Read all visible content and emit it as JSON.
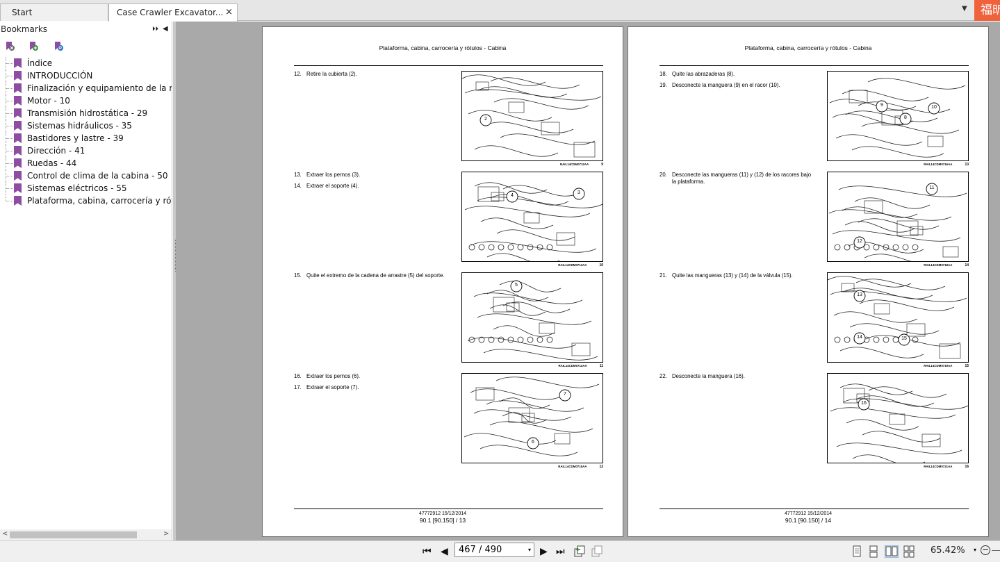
{
  "tabs": [
    {
      "label": "Start"
    },
    {
      "label": "Case Crawler Excavator...",
      "close": "×"
    }
  ],
  "tab_menu": "▼",
  "brand": "福昕",
  "sidebar": {
    "title": "Bookmarks",
    "expand": "⏵⏵",
    "collapse": "◀",
    "tools": [
      "delete-bookmark-icon",
      "add-bookmark-icon",
      "find-bookmark-icon"
    ],
    "items": [
      {
        "label": "Índice"
      },
      {
        "label": "INTRODUCCIÓN"
      },
      {
        "label": "Finalización y equipamiento de la máqu"
      },
      {
        "label": "Motor - 10"
      },
      {
        "label": "Transmisión hidrostática - 29"
      },
      {
        "label": "Sistemas hidráulicos - 35"
      },
      {
        "label": "Bastidores y lastre - 39"
      },
      {
        "label": "Dirección - 41"
      },
      {
        "label": "Ruedas - 44"
      },
      {
        "label": "Control de clima de la cabina - 50"
      },
      {
        "label": "Sistemas eléctricos - 55"
      },
      {
        "label": "Plataforma, cabina, carrocería y rótulos"
      }
    ],
    "scroll_left": "<",
    "scroll_right": ">"
  },
  "pages": [
    {
      "header": "Plataforma, cabina, carrocería y rótulos - Cabina",
      "steps": [
        {
          "n": "12.",
          "text": "Retire la cubierta (2)."
        },
        {
          "n": "13.",
          "text": "Extraer los pernos (3)."
        },
        {
          "n": "14.",
          "text": "Extraer el soporte (4)."
        },
        {
          "n": "15.",
          "text": "Quite el extremo de la cadena de arrastre (5) del soporte."
        },
        {
          "n": "16.",
          "text": "Extraer los pernos (6)."
        },
        {
          "n": "17.",
          "text": "Extraer el soporte (7)."
        }
      ],
      "figures": [
        {
          "code": "RAIL14CDM0712AA",
          "num": "9",
          "callouts": [
            "2"
          ]
        },
        {
          "code": "RAIL14CDM0713AA",
          "num": "10",
          "callouts": [
            "4",
            "3"
          ]
        },
        {
          "code": "RAIL14CDM0714AA",
          "num": "11",
          "callouts": [
            "5"
          ]
        },
        {
          "code": "RAIL14CDM0715AA",
          "num": "12",
          "callouts": [
            "7",
            "6"
          ]
        }
      ],
      "footer_line1": "47772912 15/12/2014",
      "footer_line2": "90.1 [90.150] / 13"
    },
    {
      "header": "Plataforma, cabina, carrocería y rótulos - Cabina",
      "steps": [
        {
          "n": "18.",
          "text": "Quite las abrazaderas (8)."
        },
        {
          "n": "19.",
          "text": "Desconecte la manguera (9) en el racor (10)."
        },
        {
          "n": "20.",
          "text": "Desconecte las mangueras (11) y (12) de los racores bajo la plataforma."
        },
        {
          "n": "21.",
          "text": "Quite las mangueras (13) y (14) de la válvula (15)."
        },
        {
          "n": "22.",
          "text": "Desconecte la manguera (16)."
        }
      ],
      "figures": [
        {
          "code": "RAIL14CDM0716AA",
          "num": "13",
          "callouts": [
            "9",
            "10",
            "8"
          ]
        },
        {
          "code": "RAIL14CDM0718AA",
          "num": "14",
          "callouts": [
            "11",
            "12"
          ]
        },
        {
          "code": "RAIL14CDM0719AA",
          "num": "15",
          "callouts": [
            "13",
            "14",
            "15"
          ]
        },
        {
          "code": "RAIL14CDM0721AA",
          "num": "16",
          "callouts": [
            "16"
          ]
        }
      ],
      "footer_line1": "47772912 15/12/2014",
      "footer_line2": "90.1 [90.150] / 14"
    }
  ],
  "statusbar": {
    "first": "⏮",
    "prev": "◀",
    "page_value": "467 / 490",
    "page_dd": "▾",
    "next": "▶",
    "last": "⏭",
    "zoom": "65.42%",
    "zoom_dd": "▾",
    "zoom_out": "−"
  }
}
